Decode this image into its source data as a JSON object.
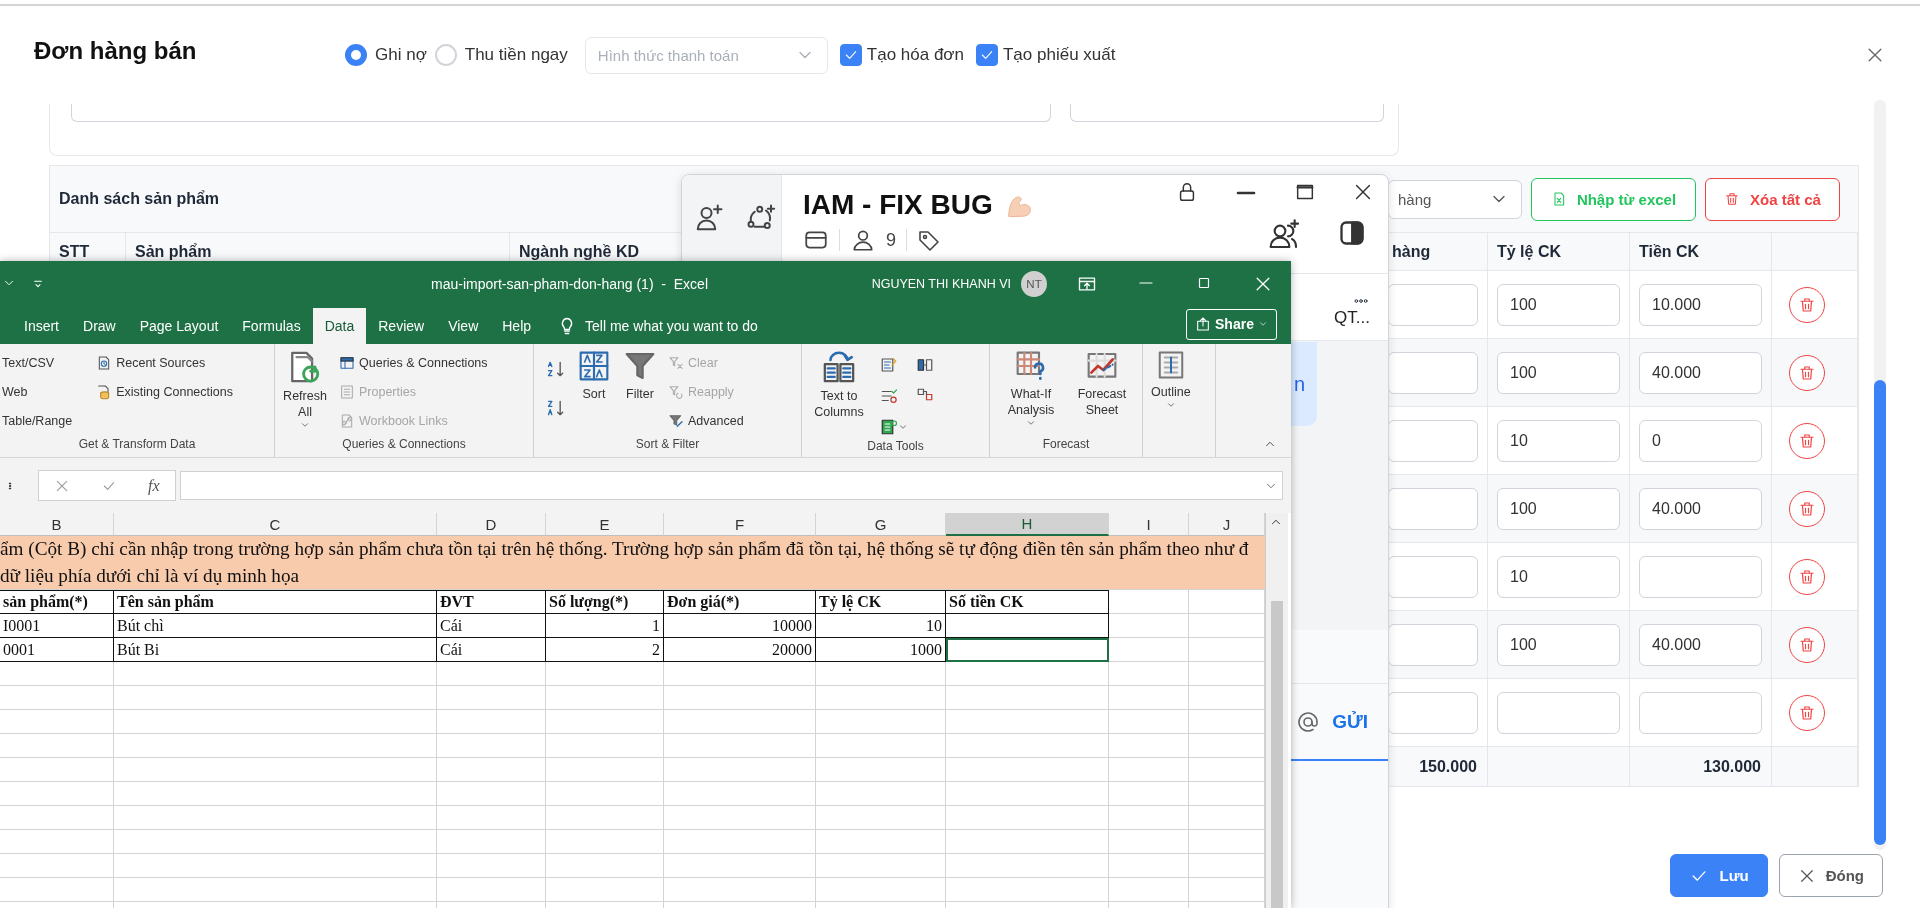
{
  "modal": {
    "title": "Đơn hàng bán",
    "payment_options": [
      {
        "label": "Ghi nợ",
        "selected": true
      },
      {
        "label": "Thu tiền ngay",
        "selected": false
      }
    ],
    "payment_method": {
      "placeholder": "Hình thức thanh toán"
    },
    "options": [
      {
        "label": "Tạo hóa đơn",
        "checked": true
      },
      {
        "label": "Tạo phiếu xuất",
        "checked": true
      }
    ],
    "products": {
      "title": "Danh sách sản phẩm",
      "type_select": {
        "placeholder": "hàng"
      },
      "buttons": [
        {
          "label": "Nhập từ excel",
          "kind": "import"
        },
        {
          "label": "Xóa tất cả",
          "kind": "clear"
        }
      ],
      "columns": [
        "STT",
        "Sản phẩm",
        "Ngành nghề KD",
        "hàng",
        "Tỷ lệ CK",
        "Tiền CK"
      ],
      "rows": [
        {
          "rate": "100",
          "discount": "10.000"
        },
        {
          "rate": "100",
          "discount": "40.000"
        },
        {
          "rate": "10",
          "discount": "0"
        },
        {
          "rate": "100",
          "discount": "40.000"
        },
        {
          "rate": "10"
        },
        {
          "rate": "100",
          "discount": "40.000"
        },
        {}
      ],
      "totals": {
        "amount": "150.000",
        "discount": "130.000"
      }
    },
    "footer_buttons": [
      {
        "label": "Lưu",
        "kind": "primary"
      },
      {
        "label": "Đóng",
        "kind": "secondary"
      }
    ]
  },
  "chat": {
    "title": "IAM - FIX BUG",
    "member_count": "9",
    "conversation_preview": "QT...",
    "message_fragment": "n",
    "send_label": "GỬI"
  },
  "excel": {
    "title": "mau-import-san-pham-don-hang (1)  -  Excel",
    "user": "NGUYEN THI KHANH VI",
    "user_initials": "NT",
    "tabs": [
      {
        "label": "Insert",
        "selected": false
      },
      {
        "label": "Draw",
        "selected": false
      },
      {
        "label": "Page Layout",
        "selected": false
      },
      {
        "label": "Formulas",
        "selected": false
      },
      {
        "label": "Data",
        "selected": true
      },
      {
        "label": "Review",
        "selected": false
      },
      {
        "label": "View",
        "selected": false
      },
      {
        "label": "Help",
        "selected": false
      }
    ],
    "tell_me": "Tell me what you want to do",
    "share": "Share",
    "ribbon_groups": [
      {
        "label": "Get & Transform Data",
        "commands": [
          {
            "label": "Text/CSV",
            "disabled": false
          },
          {
            "label": "Web",
            "disabled": false
          },
          {
            "label": "Table/Range",
            "disabled": false
          },
          {
            "label": "Recent Sources",
            "disabled": false
          },
          {
            "label": "Existing Connections",
            "disabled": false
          }
        ]
      },
      {
        "label": "Queries & Connections",
        "commands": [
          {
            "label": "Refresh All",
            "disabled": false
          },
          {
            "label": "Queries & Connections",
            "disabled": false
          },
          {
            "label": "Properties",
            "disabled": true
          },
          {
            "label": "Workbook Links",
            "disabled": true
          }
        ]
      },
      {
        "label": "Sort & Filter",
        "commands": [
          {
            "label": "Sort",
            "disabled": false
          },
          {
            "label": "Filter",
            "disabled": false
          },
          {
            "label": "Clear",
            "disabled": true
          },
          {
            "label": "Reapply",
            "disabled": true
          },
          {
            "label": "Advanced",
            "disabled": false
          }
        ]
      },
      {
        "label": "Data Tools",
        "commands": [
          {
            "label": "Text to Columns",
            "disabled": false
          }
        ]
      },
      {
        "label": "Forecast",
        "commands": [
          {
            "label": "What-If Analysis",
            "disabled": false
          },
          {
            "label": "Forecast Sheet",
            "disabled": false
          }
        ]
      },
      {
        "commands": [
          {
            "label": "Outline",
            "disabled": false
          }
        ]
      }
    ],
    "function_label": "fx",
    "sheet": {
      "columns": [
        {
          "label": "B",
          "selected": false
        },
        {
          "label": "C",
          "selected": false
        },
        {
          "label": "D",
          "selected": false
        },
        {
          "label": "E",
          "selected": false
        },
        {
          "label": "F",
          "selected": false
        },
        {
          "label": "G",
          "selected": false
        },
        {
          "label": "H",
          "selected": true
        },
        {
          "label": "I",
          "selected": false
        },
        {
          "label": "J",
          "selected": false
        }
      ],
      "note": [
        "ẩm (Cột B) chỉ cần nhập trong trường hợp sản phẩm chưa tồn tại trên hệ thống. Trường hợp sản phẩm đã tồn tại, hệ thống sẽ tự động điền tên sản phẩm theo như đ",
        "dữ liệu phía dưới chỉ là ví dụ minh họa"
      ],
      "header": [
        "sản phẩm(*)",
        "Tên sản phẩm",
        "ĐVT",
        "Số lượng(*)",
        "Đơn giá(*)",
        "Tỷ lệ CK",
        "Số tiền CK"
      ],
      "rows": [
        {
          "cells": [
            {
              "text": "I0001",
              "selected": false
            },
            {
              "text": "Bút chì",
              "selected": false
            },
            {
              "text": "Cái",
              "selected": false
            },
            {
              "text": "1",
              "selected": false
            },
            {
              "text": "10000",
              "selected": false
            },
            {
              "text": "10",
              "selected": false
            },
            {
              "selected": false
            }
          ]
        },
        {
          "cells": [
            {
              "text": "0001",
              "selected": false
            },
            {
              "text": "Bút Bi",
              "selected": false
            },
            {
              "text": "Cái",
              "selected": false
            },
            {
              "text": "2",
              "selected": false
            },
            {
              "text": "20000",
              "selected": false
            },
            {
              "text": "1000",
              "selected": false
            },
            {
              "selected": true
            }
          ]
        }
      ]
    }
  }
}
